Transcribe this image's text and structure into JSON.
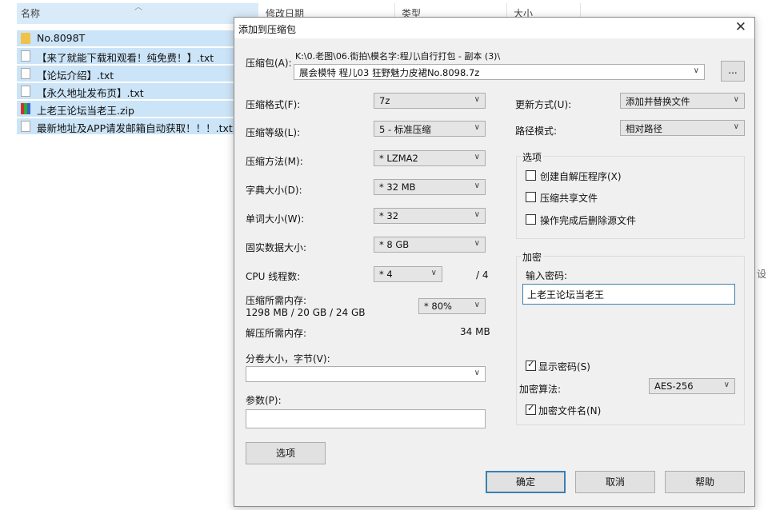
{
  "explorer": {
    "columns": [
      "名称",
      "修改日期",
      "类型",
      "大小"
    ],
    "files": [
      {
        "name": "No.8098T",
        "icon": "folder-icon"
      },
      {
        "name": "【来了就能下载和观看！纯免费！】.txt",
        "icon": "text-file-icon"
      },
      {
        "name": "【论坛介绍】.txt",
        "icon": "text-file-icon"
      },
      {
        "name": "【永久地址发布页】.txt",
        "icon": "text-file-icon"
      },
      {
        "name": "上老王论坛当老王.zip",
        "icon": "archive-icon"
      },
      {
        "name": "最新地址及APP请发邮箱自动获取！！！.txt",
        "icon": "text-file-icon"
      }
    ],
    "stray_right": "设"
  },
  "dialog": {
    "title": "添加到压缩包",
    "close_icon": "close-icon",
    "archive_label": "压缩包(A):",
    "archive_path": "K:\\0.老图\\06.街拍\\模名字:程儿\\自行打包 - 副本 (3)\\",
    "archive_name": "展会模特 程儿03 狂野魅力皮裙No.8098.7z",
    "browse_label": "...",
    "format_label": "压缩格式(F):",
    "format_value": "7z",
    "level_label": "压缩等级(L):",
    "level_value": "5 - 标准压缩",
    "method_label": "压缩方法(M):",
    "method_value": "* LZMA2",
    "dict_label": "字典大小(D):",
    "dict_value": "* 32 MB",
    "word_label": "单词大小(W):",
    "word_value": "* 32",
    "solid_label": "固实数据大小:",
    "solid_value": "* 8 GB",
    "cpu_label": "CPU 线程数:",
    "cpu_value": "* 4",
    "cpu_max": "/ 4",
    "mem_label": "压缩所需内存:",
    "mem_detail": "1298 MB / 20 GB / 24 GB",
    "mem_percent": "* 80%",
    "decomp_label": "解压所需内存:",
    "decomp_value": "34 MB",
    "split_label": "分卷大小，字节(V):",
    "split_value": "",
    "params_label": "参数(P):",
    "params_value": "",
    "options_button": "选项",
    "update_label": "更新方式(U):",
    "update_value": "添加并替换文件",
    "path_label": "路径模式:",
    "path_value": "相对路径",
    "options_group": "选项",
    "opt_sfx": "创建自解压程序(X)",
    "opt_shared": "压缩共享文件",
    "opt_delete": "操作完成后删除源文件",
    "encrypt_group": "加密",
    "password_label": "输入密码:",
    "password_value": "上老王论坛当老王",
    "show_password": "显示密码(S)",
    "enc_method_label": "加密算法:",
    "enc_method_value": "AES-256",
    "encrypt_names": "加密文件名(N)",
    "ok_button": "确定",
    "cancel_button": "取消",
    "help_button": "帮助"
  }
}
